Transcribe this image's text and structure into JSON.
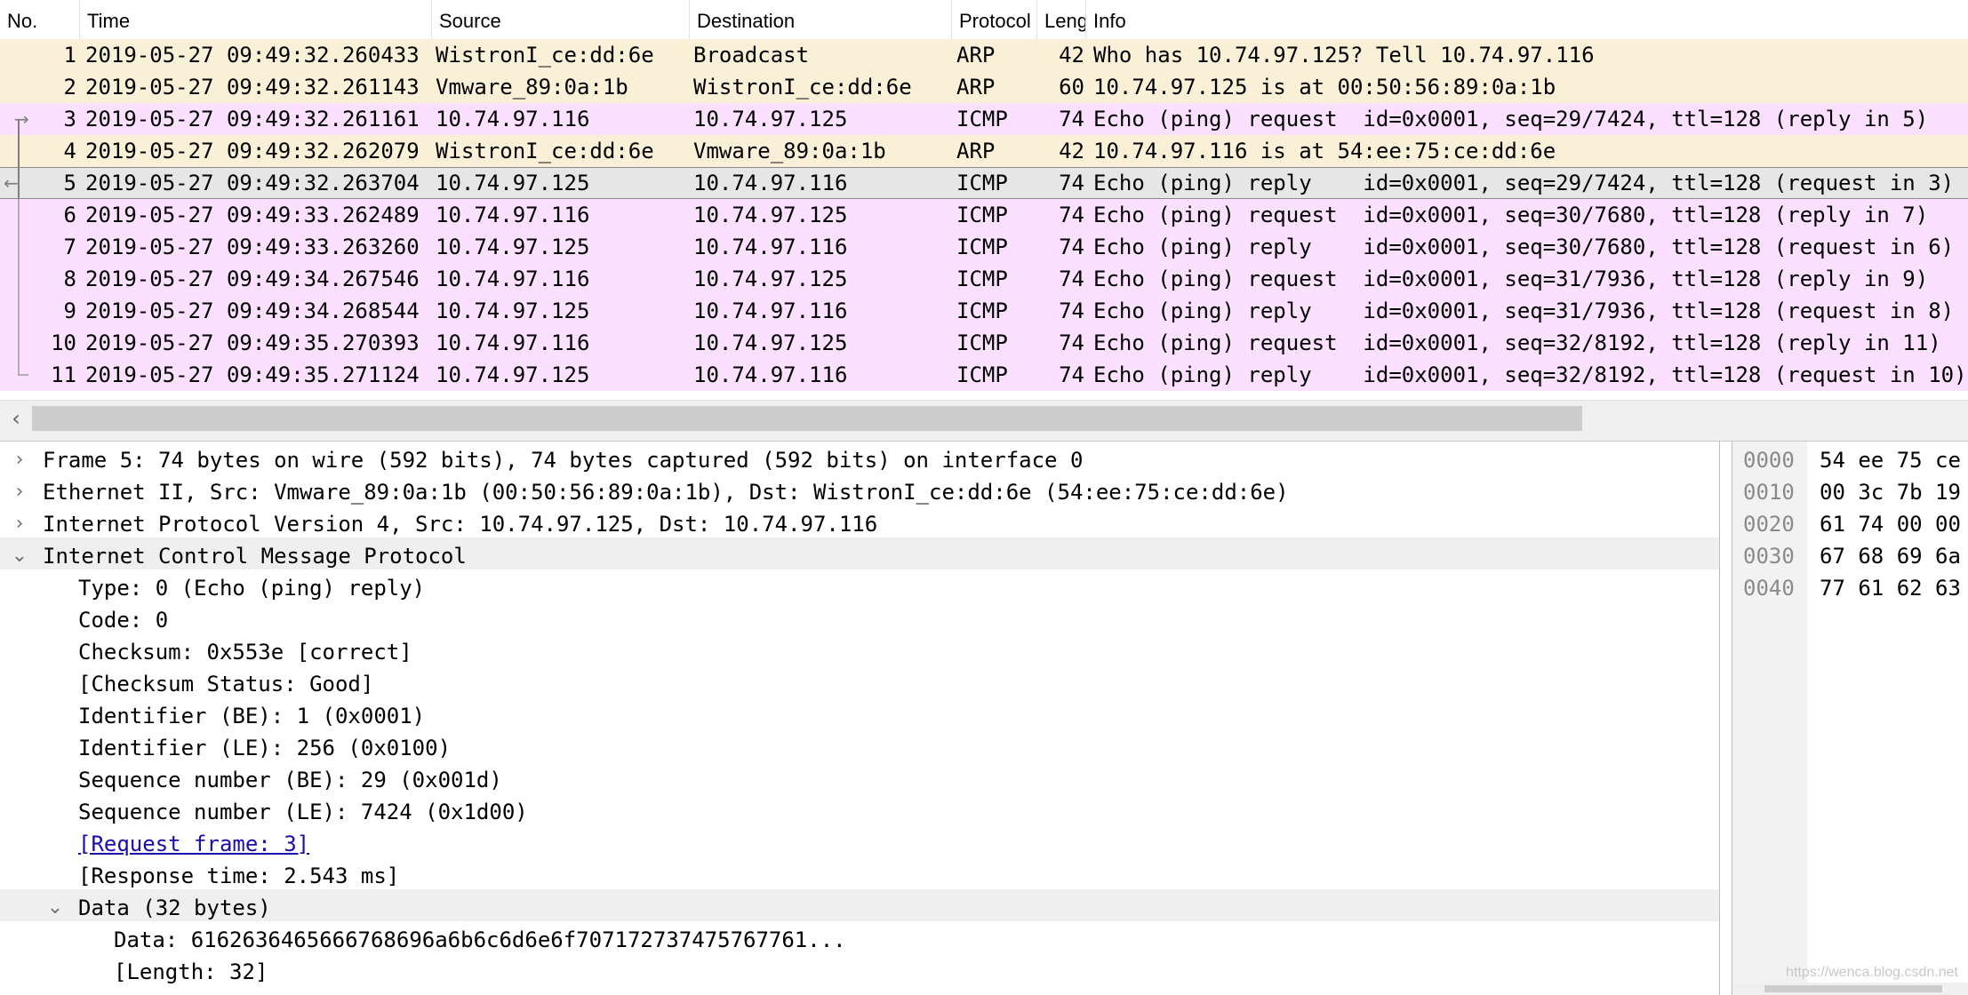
{
  "columns": {
    "no": "No.",
    "time": "Time",
    "source": "Source",
    "destination": "Destination",
    "protocol": "Protocol",
    "length": "Leng",
    "info": "Info"
  },
  "packets": [
    {
      "no": "1",
      "time": "2019-05-27 09:49:32.260433",
      "src": "WistronI_ce:dd:6e",
      "dst": "Broadcast",
      "proto": "ARP",
      "len": "42",
      "info": "Who has 10.74.97.125? Tell 10.74.97.116"
    },
    {
      "no": "2",
      "time": "2019-05-27 09:49:32.261143",
      "src": "Vmware_89:0a:1b",
      "dst": "WistronI_ce:dd:6e",
      "proto": "ARP",
      "len": "60",
      "info": "10.74.97.125 is at 00:50:56:89:0a:1b"
    },
    {
      "no": "3",
      "time": "2019-05-27 09:49:32.261161",
      "src": "10.74.97.116",
      "dst": "10.74.97.125",
      "proto": "ICMP",
      "len": "74",
      "info": "Echo (ping) request  id=0x0001, seq=29/7424, ttl=128 (reply in 5)"
    },
    {
      "no": "4",
      "time": "2019-05-27 09:49:32.262079",
      "src": "WistronI_ce:dd:6e",
      "dst": "Vmware_89:0a:1b",
      "proto": "ARP",
      "len": "42",
      "info": "10.74.97.116 is at 54:ee:75:ce:dd:6e"
    },
    {
      "no": "5",
      "time": "2019-05-27 09:49:32.263704",
      "src": "10.74.97.125",
      "dst": "10.74.97.116",
      "proto": "ICMP",
      "len": "74",
      "info": "Echo (ping) reply    id=0x0001, seq=29/7424, ttl=128 (request in 3)"
    },
    {
      "no": "6",
      "time": "2019-05-27 09:49:33.262489",
      "src": "10.74.97.116",
      "dst": "10.74.97.125",
      "proto": "ICMP",
      "len": "74",
      "info": "Echo (ping) request  id=0x0001, seq=30/7680, ttl=128 (reply in 7)"
    },
    {
      "no": "7",
      "time": "2019-05-27 09:49:33.263260",
      "src": "10.74.97.125",
      "dst": "10.74.97.116",
      "proto": "ICMP",
      "len": "74",
      "info": "Echo (ping) reply    id=0x0001, seq=30/7680, ttl=128 (request in 6)"
    },
    {
      "no": "8",
      "time": "2019-05-27 09:49:34.267546",
      "src": "10.74.97.116",
      "dst": "10.74.97.125",
      "proto": "ICMP",
      "len": "74",
      "info": "Echo (ping) request  id=0x0001, seq=31/7936, ttl=128 (reply in 9)"
    },
    {
      "no": "9",
      "time": "2019-05-27 09:49:34.268544",
      "src": "10.74.97.125",
      "dst": "10.74.97.116",
      "proto": "ICMP",
      "len": "74",
      "info": "Echo (ping) reply    id=0x0001, seq=31/7936, ttl=128 (request in 8)"
    },
    {
      "no": "10",
      "time": "2019-05-27 09:49:35.270393",
      "src": "10.74.97.116",
      "dst": "10.74.97.125",
      "proto": "ICMP",
      "len": "74",
      "info": "Echo (ping) request  id=0x0001, seq=32/8192, ttl=128 (reply in 11)"
    },
    {
      "no": "11",
      "time": "2019-05-27 09:49:35.271124",
      "src": "10.74.97.125",
      "dst": "10.74.97.116",
      "proto": "ICMP",
      "len": "74",
      "info": "Echo (ping) reply    id=0x0001, seq=32/8192, ttl=128 (request in 10)"
    }
  ],
  "details": [
    {
      "text": "Frame 5: 74 bytes on wire (592 bits), 74 bytes captured (592 bits) on interface 0",
      "expander": "›"
    },
    {
      "text": "Ethernet II, Src: Vmware_89:0a:1b (00:50:56:89:0a:1b), Dst: WistronI_ce:dd:6e (54:ee:75:ce:dd:6e)",
      "expander": "›"
    },
    {
      "text": "Internet Protocol Version 4, Src: 10.74.97.125, Dst: 10.74.97.116",
      "expander": "›"
    },
    {
      "text": "Internet Control Message Protocol",
      "expander": "⌄"
    },
    {
      "text": "Type: 0 (Echo (ping) reply)"
    },
    {
      "text": "Code: 0"
    },
    {
      "text": "Checksum: 0x553e [correct]"
    },
    {
      "text": "[Checksum Status: Good]"
    },
    {
      "text": "Identifier (BE): 1 (0x0001)"
    },
    {
      "text": "Identifier (LE): 256 (0x0100)"
    },
    {
      "text": "Sequence number (BE): 29 (0x001d)"
    },
    {
      "text": "Sequence number (LE): 7424 (0x1d00)"
    },
    {
      "text": "[Request frame: 3]"
    },
    {
      "text": "[Response time: 2.543 ms]"
    },
    {
      "text": "Data (32 bytes)",
      "expander": "⌄"
    },
    {
      "text": "Data: 6162636465666768696a6b6c6d6e6f707172737475767761..."
    },
    {
      "text": "[Length: 32]"
    }
  ],
  "bytes": [
    {
      "offset": "0000",
      "hex": "54 ee 75 ce"
    },
    {
      "offset": "0010",
      "hex": "00 3c 7b 19"
    },
    {
      "offset": "0020",
      "hex": "61 74 00 00"
    },
    {
      "offset": "0030",
      "hex": "67 68 69 6a"
    },
    {
      "offset": "0040",
      "hex": "77 61 62 63"
    }
  ],
  "scroll": {
    "left_arrow": "‹"
  },
  "relation": {
    "request_arrow": "→",
    "reply_arrow": "←"
  },
  "watermark": "https://wenca.blog.csdn.net",
  "colors": {
    "arp_row": "#faf0d7",
    "icmp_row": "#fce0ff",
    "selected_row": "#e6e6e6",
    "link": "#1a0dab"
  }
}
